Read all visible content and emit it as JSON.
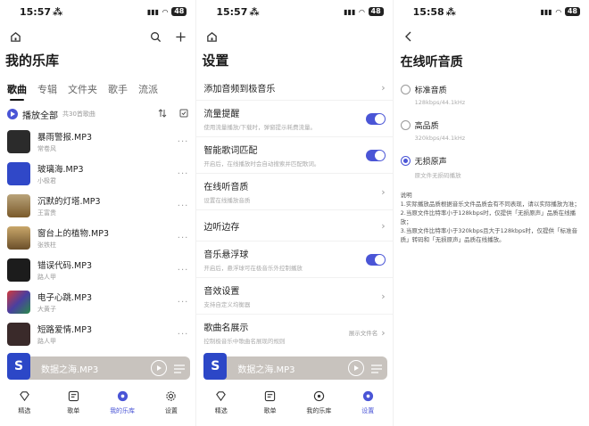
{
  "colors": {
    "accent": "#4a55d6",
    "mini_player_bg": "#c8c3be"
  },
  "screens": {
    "library": {
      "time": "15:57",
      "battery": "48",
      "title": "我的乐库",
      "tabs": [
        "歌曲",
        "专辑",
        "文件夹",
        "歌手",
        "流派"
      ],
      "play_all": "播放全部",
      "song_count": "共30首歌曲",
      "songs": [
        {
          "title": "暴雨警报.MP3",
          "artist": "常卷风",
          "cover": "#2b2b2b"
        },
        {
          "title": "玻璃海.MP3",
          "artist": "小极君",
          "cover": "#3048c8"
        },
        {
          "title": "沉默的灯塔.MP3",
          "artist": "王富贵",
          "cover": "#a37b3e"
        },
        {
          "title": "窗台上的植物.MP3",
          "artist": "张铁柱",
          "cover": "#8a6a3a"
        },
        {
          "title": "错误代码.MP3",
          "artist": "路人甲",
          "cover": "#1c1c1c"
        },
        {
          "title": "电子心跳.MP3",
          "artist": "大黄子",
          "cover": "#6b3fa0"
        },
        {
          "title": "短路爱情.MP3",
          "artist": "路人甲",
          "cover": "#3a2a2a"
        }
      ],
      "now_playing": "数据之海.MP3",
      "tabbar": [
        "精选",
        "歌单",
        "我的乐库",
        "设置"
      ]
    },
    "settings": {
      "time": "15:57",
      "battery": "48",
      "title": "设置",
      "items": [
        {
          "title": "添加音频到极音乐",
          "desc": "",
          "control": "chevron"
        },
        {
          "title": "流量提醒",
          "desc": "使用流量播放/下载时，弹窗提示耗费流量。",
          "control": "toggle"
        },
        {
          "title": "智能歌词匹配",
          "desc": "开启后，在线播放时会自动搜索并匹配歌词。",
          "control": "toggle"
        },
        {
          "title": "在线听音质",
          "desc": "设置在线播放音质",
          "control": "chevron"
        },
        {
          "title": "边听边存",
          "desc": "",
          "control": "chevron"
        },
        {
          "title": "音乐悬浮球",
          "desc": "开启后，悬浮球可在极音乐外控制播放",
          "control": "toggle"
        },
        {
          "title": "音效设置",
          "desc": "支持自定义均衡器",
          "control": "chevron"
        },
        {
          "title": "歌曲名展示",
          "desc": "控制极音乐中歌曲名展现的规则",
          "control": "value",
          "value": "展示文件名"
        }
      ],
      "now_playing": "数据之海.MP3",
      "tabbar": [
        "精选",
        "歌单",
        "我的乐库",
        "设置"
      ]
    },
    "quality": {
      "time": "15:58",
      "battery": "48",
      "title": "在线听音质",
      "options": [
        {
          "label": "标准音质",
          "desc": "128kbps/44.1kHz",
          "checked": false
        },
        {
          "label": "高品质",
          "desc": "320kbps/44.1kHz",
          "checked": false
        },
        {
          "label": "无损原声",
          "desc": "原文件无损码播放",
          "checked": true
        }
      ],
      "notes_title": "说明",
      "notes": [
        "1.实际播放品质根据音乐文件品质会有不同表现，请以实际播放为准；",
        "2.当原文件比特率小于128kbps时，仅提供「无损原声」品质在线播放；",
        "3.当原文件比特率小于320kbps且大于128kbps时，仅提供「标准音质」转码和「无损原声」品质在线播放。"
      ]
    }
  }
}
